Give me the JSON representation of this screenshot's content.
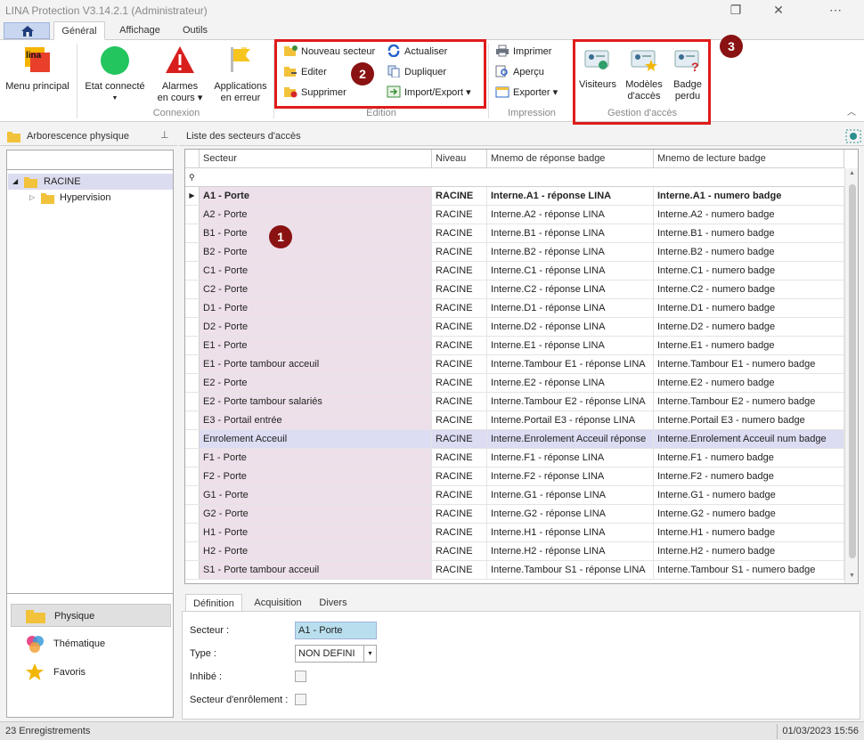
{
  "window": {
    "title": "LINA Protection  V3.14.2.1  (Administrateur)"
  },
  "ribbon_tabs": [
    "Général",
    "Affichage",
    "Outils"
  ],
  "ribbon": {
    "menu_principal": "Menu principal",
    "logo_text": "lina",
    "etat_connecte": "Etat connecté",
    "alarmes_en_cours": [
      "Alarmes",
      "en cours"
    ],
    "applications_en_erreur": [
      "Applications",
      "en erreur"
    ],
    "group_connexion": "Connexion",
    "nouveau_secteur": "Nouveau secteur",
    "editer": "Editer",
    "supprimer": "Supprimer",
    "actualiser": "Actualiser",
    "dupliquer": "Dupliquer",
    "import_export": "Import/Export",
    "group_edition": "Edition",
    "imprimer": "Imprimer",
    "apercu": "Aperçu",
    "exporter": "Exporter",
    "group_impression": "Impression",
    "visiteurs": "Visiteurs",
    "modeles_acces": [
      "Modèles",
      "d'accès"
    ],
    "badge_perdu": [
      "Badge",
      "perdu"
    ],
    "group_gestion_acces": "Gestion d'accès"
  },
  "callouts": [
    "1",
    "2",
    "3"
  ],
  "left_panel": {
    "title": "Arborescence physique",
    "tree": [
      {
        "label": "RACINE",
        "level": 0,
        "selected": true
      },
      {
        "label": "Hypervision",
        "level": 1,
        "selected": false
      }
    ],
    "nav": [
      "Physique",
      "Thématique",
      "Favoris"
    ]
  },
  "main": {
    "title": "Liste des secteurs d'accès",
    "columns": [
      "Secteur",
      "Niveau",
      "Mnemo de réponse badge",
      "Mnemo de lecture badge"
    ],
    "rows": [
      [
        "A1 - Porte",
        "RACINE",
        "Interne.A1 - réponse LINA",
        "Interne.A1 - numero badge"
      ],
      [
        "A2 - Porte",
        "RACINE",
        "Interne.A2 - réponse LINA",
        "Interne.A2 - numero badge"
      ],
      [
        "B1 - Porte",
        "RACINE",
        "Interne.B1 - réponse LINA",
        "Interne.B1 - numero badge"
      ],
      [
        "B2 - Porte",
        "RACINE",
        "Interne.B2 - réponse LINA",
        "Interne.B2 - numero badge"
      ],
      [
        "C1 - Porte",
        "RACINE",
        "Interne.C1 - réponse LINA",
        "Interne.C1 - numero badge"
      ],
      [
        "C2 - Porte",
        "RACINE",
        "Interne.C2 - réponse LINA",
        "Interne.C2 - numero badge"
      ],
      [
        "D1 - Porte",
        "RACINE",
        "Interne.D1 - réponse LINA",
        "Interne.D1 - numero badge"
      ],
      [
        "D2 - Porte",
        "RACINE",
        "Interne.D2 - réponse LINA",
        "Interne.D2 - numero badge"
      ],
      [
        "E1 - Porte",
        "RACINE",
        "Interne.E1 - réponse LINA",
        "Interne.E1 - numero badge"
      ],
      [
        "E1 - Porte tambour acceuil",
        "RACINE",
        "Interne.Tambour E1 - réponse LINA",
        "Interne.Tambour E1 - numero badge"
      ],
      [
        "E2 - Porte",
        "RACINE",
        "Interne.E2 - réponse LINA",
        "Interne.E2 - numero badge"
      ],
      [
        "E2 - Porte tambour salariés",
        "RACINE",
        "Interne.Tambour E2 - réponse LINA",
        "Interne.Tambour E2 - numero badge"
      ],
      [
        "E3 - Portail entrée",
        "RACINE",
        "Interne.Portail E3 - réponse LINA",
        "Interne.Portail E3 - numero badge"
      ],
      [
        "Enrolement Acceuil",
        "RACINE",
        "Interne.Enrolement Acceuil réponse",
        "Interne.Enrolement Acceuil num badge"
      ],
      [
        "F1 - Porte",
        "RACINE",
        "Interne.F1 - réponse LINA",
        "Interne.F1 - numero badge"
      ],
      [
        "F2 - Porte",
        "RACINE",
        "Interne.F2 - réponse LINA",
        "Interne.F2 - numero badge"
      ],
      [
        "G1 - Porte",
        "RACINE",
        "Interne.G1 - réponse LINA",
        "Interne.G1 - numero badge"
      ],
      [
        "G2 - Porte",
        "RACINE",
        "Interne.G2 - réponse LINA",
        "Interne.G2 - numero badge"
      ],
      [
        "H1 - Porte",
        "RACINE",
        "Interne.H1 - réponse LINA",
        "Interne.H1 - numero badge"
      ],
      [
        "H2 - Porte",
        "RACINE",
        "Interne.H2 - réponse LINA",
        "Interne.H2 - numero badge"
      ],
      [
        "S1 - Porte tambour acceuil",
        "RACINE",
        "Interne.Tambour S1 - réponse LINA",
        "Interne.Tambour S1 - numero badge"
      ]
    ]
  },
  "detail": {
    "tabs": [
      "Définition",
      "Acquisition",
      "Divers"
    ],
    "secteur_label": "Secteur :",
    "secteur_value": "A1 - Porte",
    "type_label": "Type :",
    "type_value": "NON DEFINI",
    "inhibe_label": "Inhibé :",
    "enrolement_label": "Secteur d'enrôlement :"
  },
  "status": {
    "records": "23 Enregistrements",
    "datetime": "01/03/2023 15:56"
  },
  "colors": {
    "callout": "#8a1212",
    "highlight_box": "#e01b1b",
    "selected_row": "#dcdcf3",
    "first_col": "#ede0ea"
  }
}
